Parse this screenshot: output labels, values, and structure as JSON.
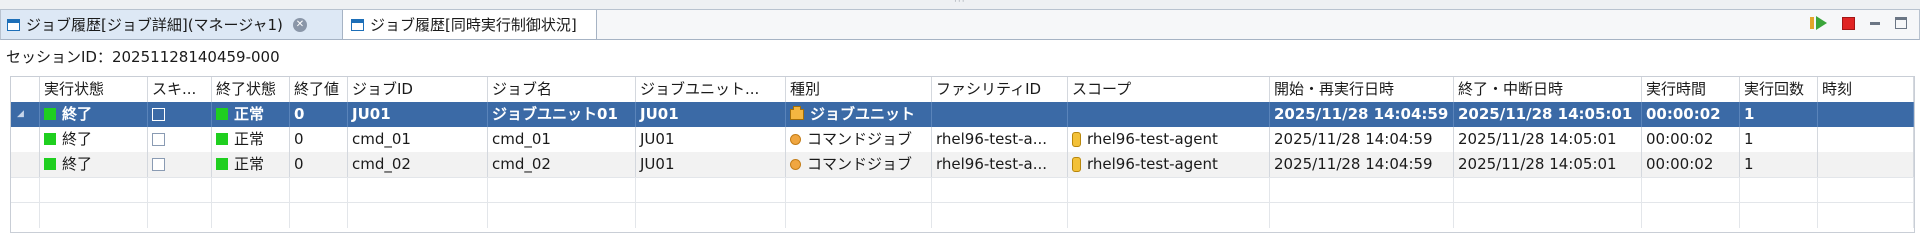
{
  "tabs": [
    {
      "label": "ジョブ履歴[ジョブ詳細](マネージャ1)",
      "active": true
    },
    {
      "label": "ジョブ履歴[同時実行制御状況]",
      "active": false
    }
  ],
  "toolbar": {
    "icons": [
      "run-icon",
      "stop-icon",
      "minimize-icon",
      "maximize-icon"
    ]
  },
  "session": {
    "text": "セッションID：20251128140459-000"
  },
  "table": {
    "columns": [
      "実行状態",
      "スキ...",
      "終了状態",
      "終了値",
      "ジョブID",
      "ジョブ名",
      "ジョブユニット...",
      "種別",
      "ファシリティID",
      "スコープ",
      "開始・再実行日時",
      "終了・中断日時",
      "実行時間",
      "実行回数",
      "時刻"
    ],
    "rows": [
      {
        "status": "終了",
        "end_status": "正常",
        "end_value": "0",
        "job_id": "JU01",
        "job_name": "ジョブユニット01",
        "jobunit": "JU01",
        "type": "ジョブユニット",
        "facility_id": "",
        "scope": "",
        "start": "2025/11/28 14:04:59",
        "end": "2025/11/28 14:05:01",
        "duration": "00:00:02",
        "runs": "1"
      },
      {
        "status": "終了",
        "end_status": "正常",
        "end_value": "0",
        "job_id": "cmd_01",
        "job_name": "cmd_01",
        "jobunit": "JU01",
        "type": "コマンドジョブ",
        "facility_id": "rhel96-test-a...",
        "scope": "rhel96-test-agent",
        "start": "2025/11/28 14:04:59",
        "end": "2025/11/28 14:05:01",
        "duration": "00:00:02",
        "runs": "1"
      },
      {
        "status": "終了",
        "end_status": "正常",
        "end_value": "0",
        "job_id": "cmd_02",
        "job_name": "cmd_02",
        "jobunit": "JU01",
        "type": "コマンドジョブ",
        "facility_id": "rhel96-test-a...",
        "scope": "rhel96-test-agent",
        "start": "2025/11/28 14:04:59",
        "end": "2025/11/28 14:05:01",
        "duration": "00:00:02",
        "runs": "1"
      }
    ]
  },
  "colors": {
    "selected_row": "#3b6aa6",
    "status_green": "#1fcf1f",
    "stop_red": "#e02424",
    "tab_active": "#dde8f5"
  }
}
